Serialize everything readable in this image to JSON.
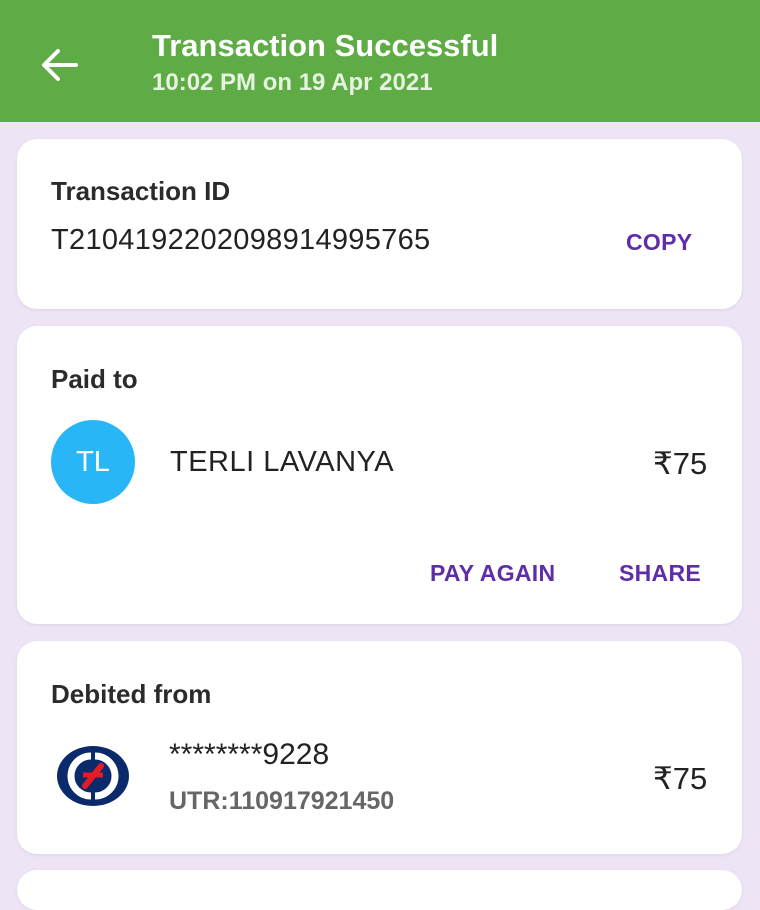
{
  "header": {
    "title": "Transaction Successful",
    "subtitle": "10:02 PM on 19 Apr 2021",
    "bg_color": "#5fac46",
    "back_icon": "arrow-left-icon"
  },
  "transaction": {
    "label": "Transaction ID",
    "id": "T2104192202098914995765",
    "copy_label": "COPY"
  },
  "paid_to": {
    "label": "Paid to",
    "avatar_initials": "TL",
    "avatar_color": "#29b6f6",
    "name": "TERLI LAVANYA",
    "amount": "₹75",
    "pay_again_label": "PAY AGAIN",
    "share_label": "SHARE"
  },
  "debited_from": {
    "label": "Debited from",
    "bank_icon": "kotak-bank-logo-icon",
    "account": "********9228",
    "utr": "UTR:110917921450",
    "amount": "₹75"
  },
  "accent_color": "#5f2da8"
}
